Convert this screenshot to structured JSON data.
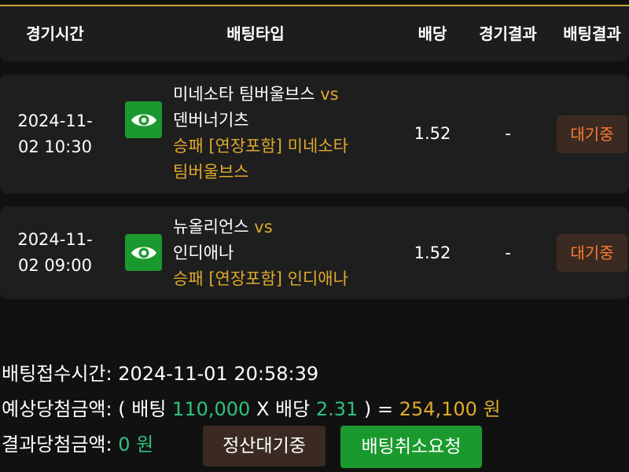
{
  "header": {
    "col_time": "경기시간",
    "col_bet_type": "배팅타입",
    "col_odds": "배당",
    "col_game_result": "경기결과",
    "col_bet_result": "배팅결과"
  },
  "bets": [
    {
      "time_line1": "2024-11-",
      "time_line2": "02 10:30",
      "home": "미네소타 팀버울브스",
      "vs": "vs",
      "away": "덴버너기츠",
      "pick_line1": "승패 [연장포함] 미네소타",
      "pick_line2": "팀버울브스",
      "odds": "1.52",
      "game_result": "-",
      "status": "대기중"
    },
    {
      "time_line1": "2024-11-",
      "time_line2": "02 09:00",
      "home": "뉴올리언스",
      "vs": "vs",
      "away": "인디애나",
      "pick_line1": "승패 [연장포함] 인디애나",
      "odds": "1.52",
      "game_result": "-",
      "status": "대기중"
    }
  ],
  "summary": {
    "received_label": "배팅접수시간:",
    "received_time": "2024-11-01 20:58:39",
    "expected_label": "예상당첨금액:",
    "open_paren": "(",
    "bet_label": "배팅",
    "bet_amount": "110,000",
    "times": "X",
    "odds_label": "배당",
    "total_odds": "2.31",
    "close_paren": ")",
    "equals": "=",
    "expected_amount": "254,100",
    "won": "원",
    "result_label": "결과당첨금액:",
    "result_amount": "0 원"
  },
  "buttons": {
    "pending_label": "정산대기중",
    "cancel_label": "배팅취소요청"
  },
  "colors": {
    "accent_gold": "#e0aa2c",
    "accent_green": "#1a9a2e",
    "status_orange": "#ff7a2f"
  },
  "icons": {
    "view": "eye-icon"
  }
}
